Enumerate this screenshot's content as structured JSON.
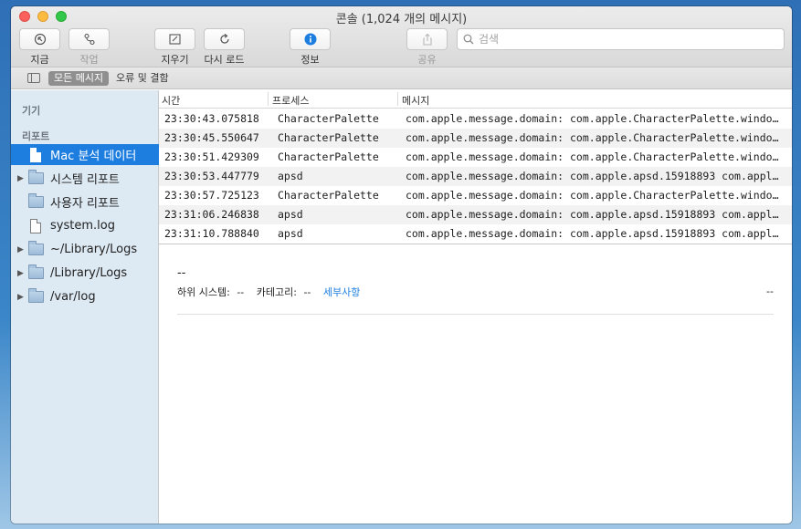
{
  "window": {
    "title": "콘솔 (1,024 개의 메시지)"
  },
  "toolbar": {
    "now_label": "지금",
    "activities_label": "작업",
    "clear_label": "지우기",
    "reload_label": "다시 로드",
    "info_label": "정보",
    "share_label": "공유",
    "search_placeholder": "검색",
    "accent_color": "#1d7ee0"
  },
  "filterbar": {
    "all_messages": "모든 메시지",
    "errors_and_faults": "오류 및 결함"
  },
  "sidebar": {
    "devices_header": "기기",
    "reports_header": "리포트",
    "items": [
      {
        "label": "Mac 분석 데이터",
        "icon": "doc-icon",
        "expandable": false,
        "selected": true
      },
      {
        "label": "시스템 리포트",
        "icon": "folder-icon",
        "expandable": true,
        "selected": false
      },
      {
        "label": "사용자 리포트",
        "icon": "folder-icon",
        "expandable": false,
        "selected": false
      },
      {
        "label": "system.log",
        "icon": "doc-icon",
        "expandable": false,
        "selected": false
      },
      {
        "label": "~/Library/Logs",
        "icon": "folder-icon",
        "expandable": true,
        "selected": false
      },
      {
        "label": "/Library/Logs",
        "icon": "folder-icon",
        "expandable": true,
        "selected": false
      },
      {
        "label": "/var/log",
        "icon": "folder-icon",
        "expandable": true,
        "selected": false
      }
    ]
  },
  "table": {
    "columns": [
      "시간",
      "프로세스",
      "메시지"
    ],
    "rows": [
      {
        "time": "23:30:43.075818",
        "process": "CharacterPalette",
        "message": "com.apple.message.domain: com.apple.CharacterPalette.window…"
      },
      {
        "time": "23:30:45.550647",
        "process": "CharacterPalette",
        "message": "com.apple.message.domain: com.apple.CharacterPalette.window…"
      },
      {
        "time": "23:30:51.429309",
        "process": "CharacterPalette",
        "message": "com.apple.message.domain: com.apple.CharacterPalette.window…"
      },
      {
        "time": "23:30:53.447779",
        "process": "apsd",
        "message": "com.apple.message.domain: com.apple.apsd.15918893 com.apple.…"
      },
      {
        "time": "23:30:57.725123",
        "process": "CharacterPalette",
        "message": "com.apple.message.domain: com.apple.CharacterPalette.window…"
      },
      {
        "time": "23:31:06.246838",
        "process": "apsd",
        "message": "com.apple.message.domain: com.apple.apsd.15918893 com.apple.…"
      },
      {
        "time": "23:31:10.788840",
        "process": "apsd",
        "message": "com.apple.message.domain: com.apple.apsd.15918893 com.apple.…"
      }
    ]
  },
  "detail": {
    "title": "--",
    "subsystem_label": "하위 시스템:",
    "subsystem_value": "--",
    "category_label": "카테고리:",
    "category_value": "--",
    "details_link": "세부사항",
    "right_value": "--"
  }
}
